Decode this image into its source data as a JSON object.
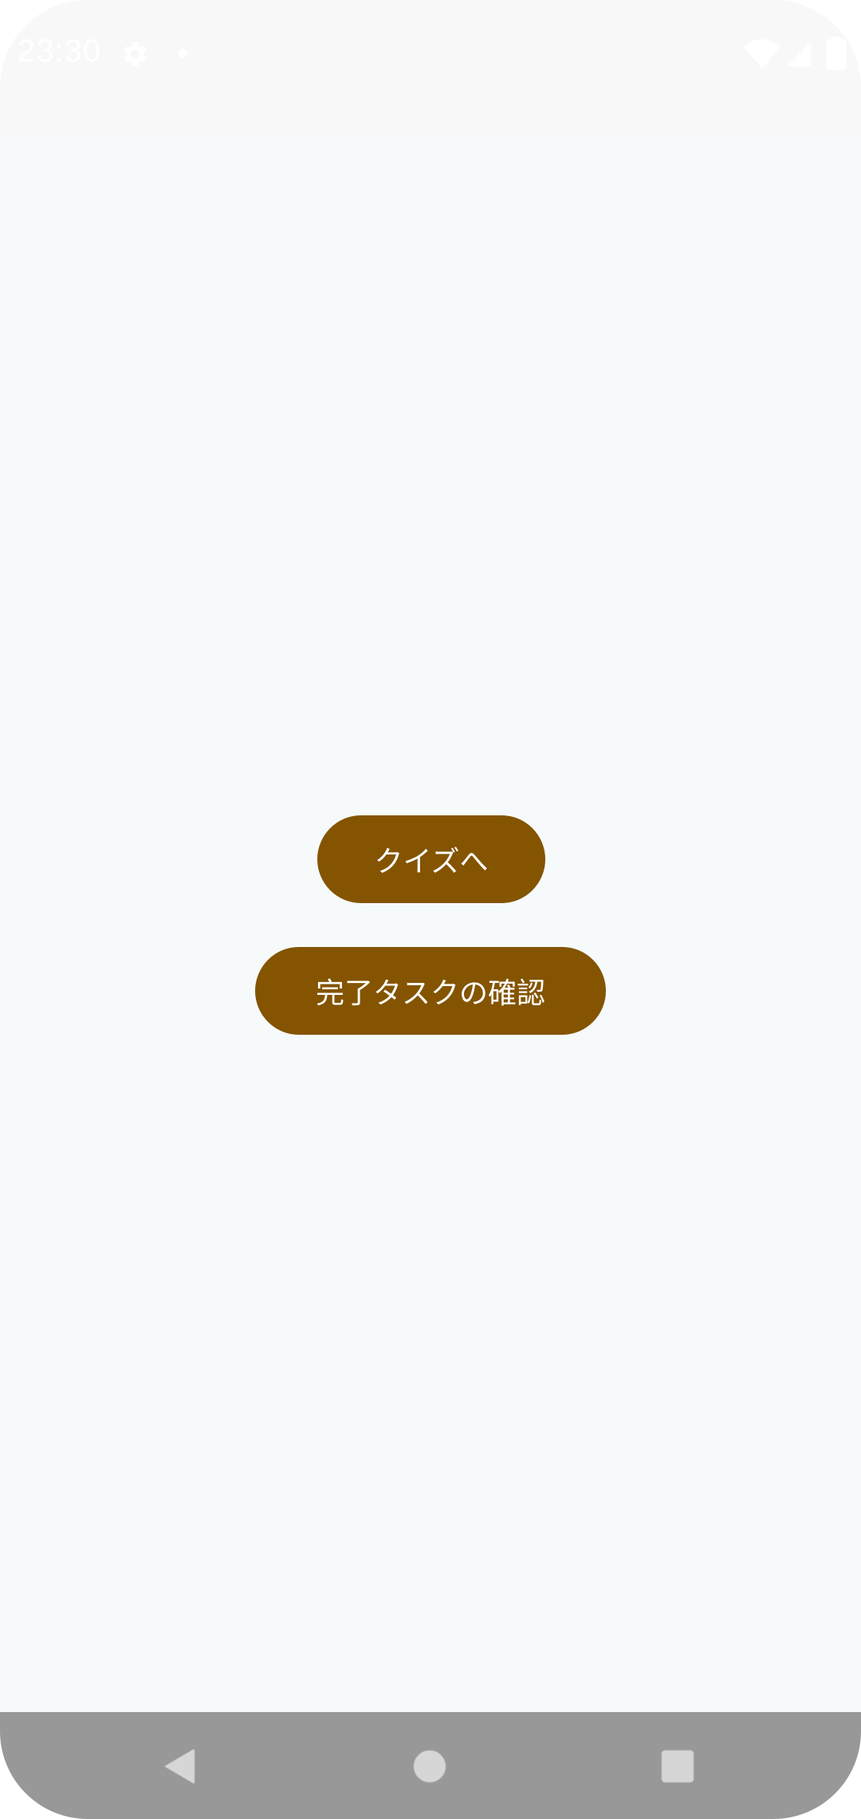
{
  "status_bar": {
    "time": "23:30",
    "icons": [
      "gear-icon",
      "dot-icon",
      "wifi-icon",
      "signal-icon",
      "battery-icon"
    ]
  },
  "main": {
    "quiz_button_label": "クイズへ",
    "tasks_button_label": "完了タスクの確認"
  },
  "nav_bar": {
    "icons": [
      "back-icon",
      "home-icon",
      "recents-icon"
    ]
  },
  "colors": {
    "accent": "#845400",
    "background": "#f6fafb",
    "nav_bar": "#989898"
  }
}
